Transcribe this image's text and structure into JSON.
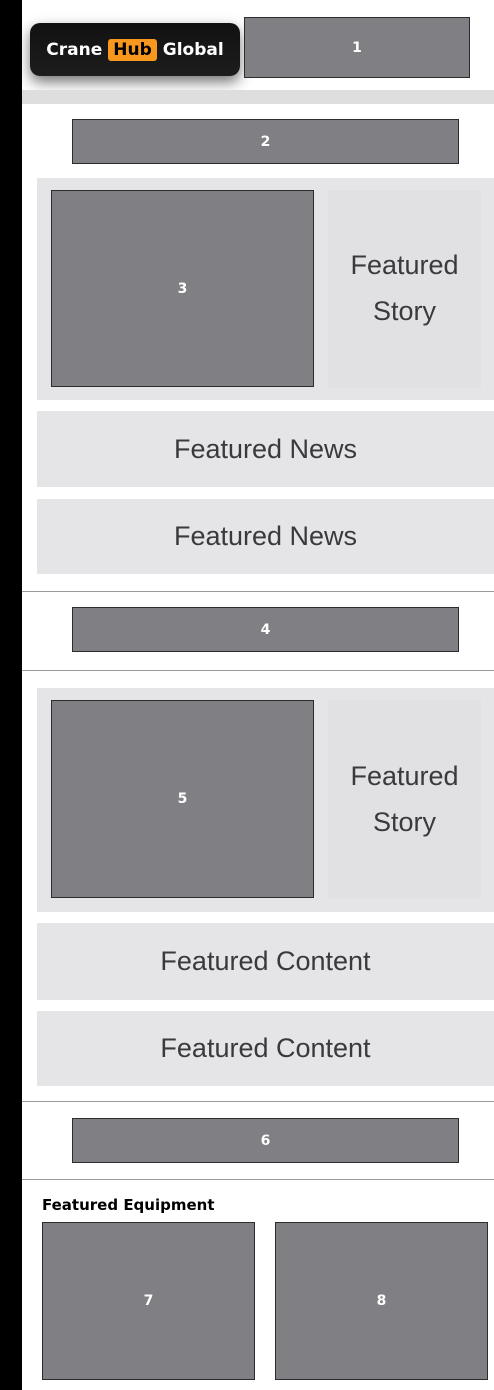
{
  "header": {
    "logo": {
      "word1": "Crane",
      "word2": "Hub",
      "word3": "Global"
    },
    "ad_slot_1": "1"
  },
  "ad_slot_2": "2",
  "section1": {
    "image_slot": "3",
    "story": {
      "line1": "Featured",
      "line2": "Story"
    },
    "news": [
      "Featured News",
      "Featured News"
    ]
  },
  "ad_slot_4": "4",
  "section2": {
    "image_slot": "5",
    "story": {
      "line1": "Featured",
      "line2": "Story"
    },
    "content": [
      "Featured Content",
      "Featured Content"
    ]
  },
  "ad_slot_6": "6",
  "equipment": {
    "title": "Featured Equipment",
    "slots": [
      "7",
      "8"
    ]
  },
  "colors": {
    "logo_accent": "#f7971d",
    "slot_gray": "#808084",
    "panel_gray": "#e5e5e7"
  }
}
